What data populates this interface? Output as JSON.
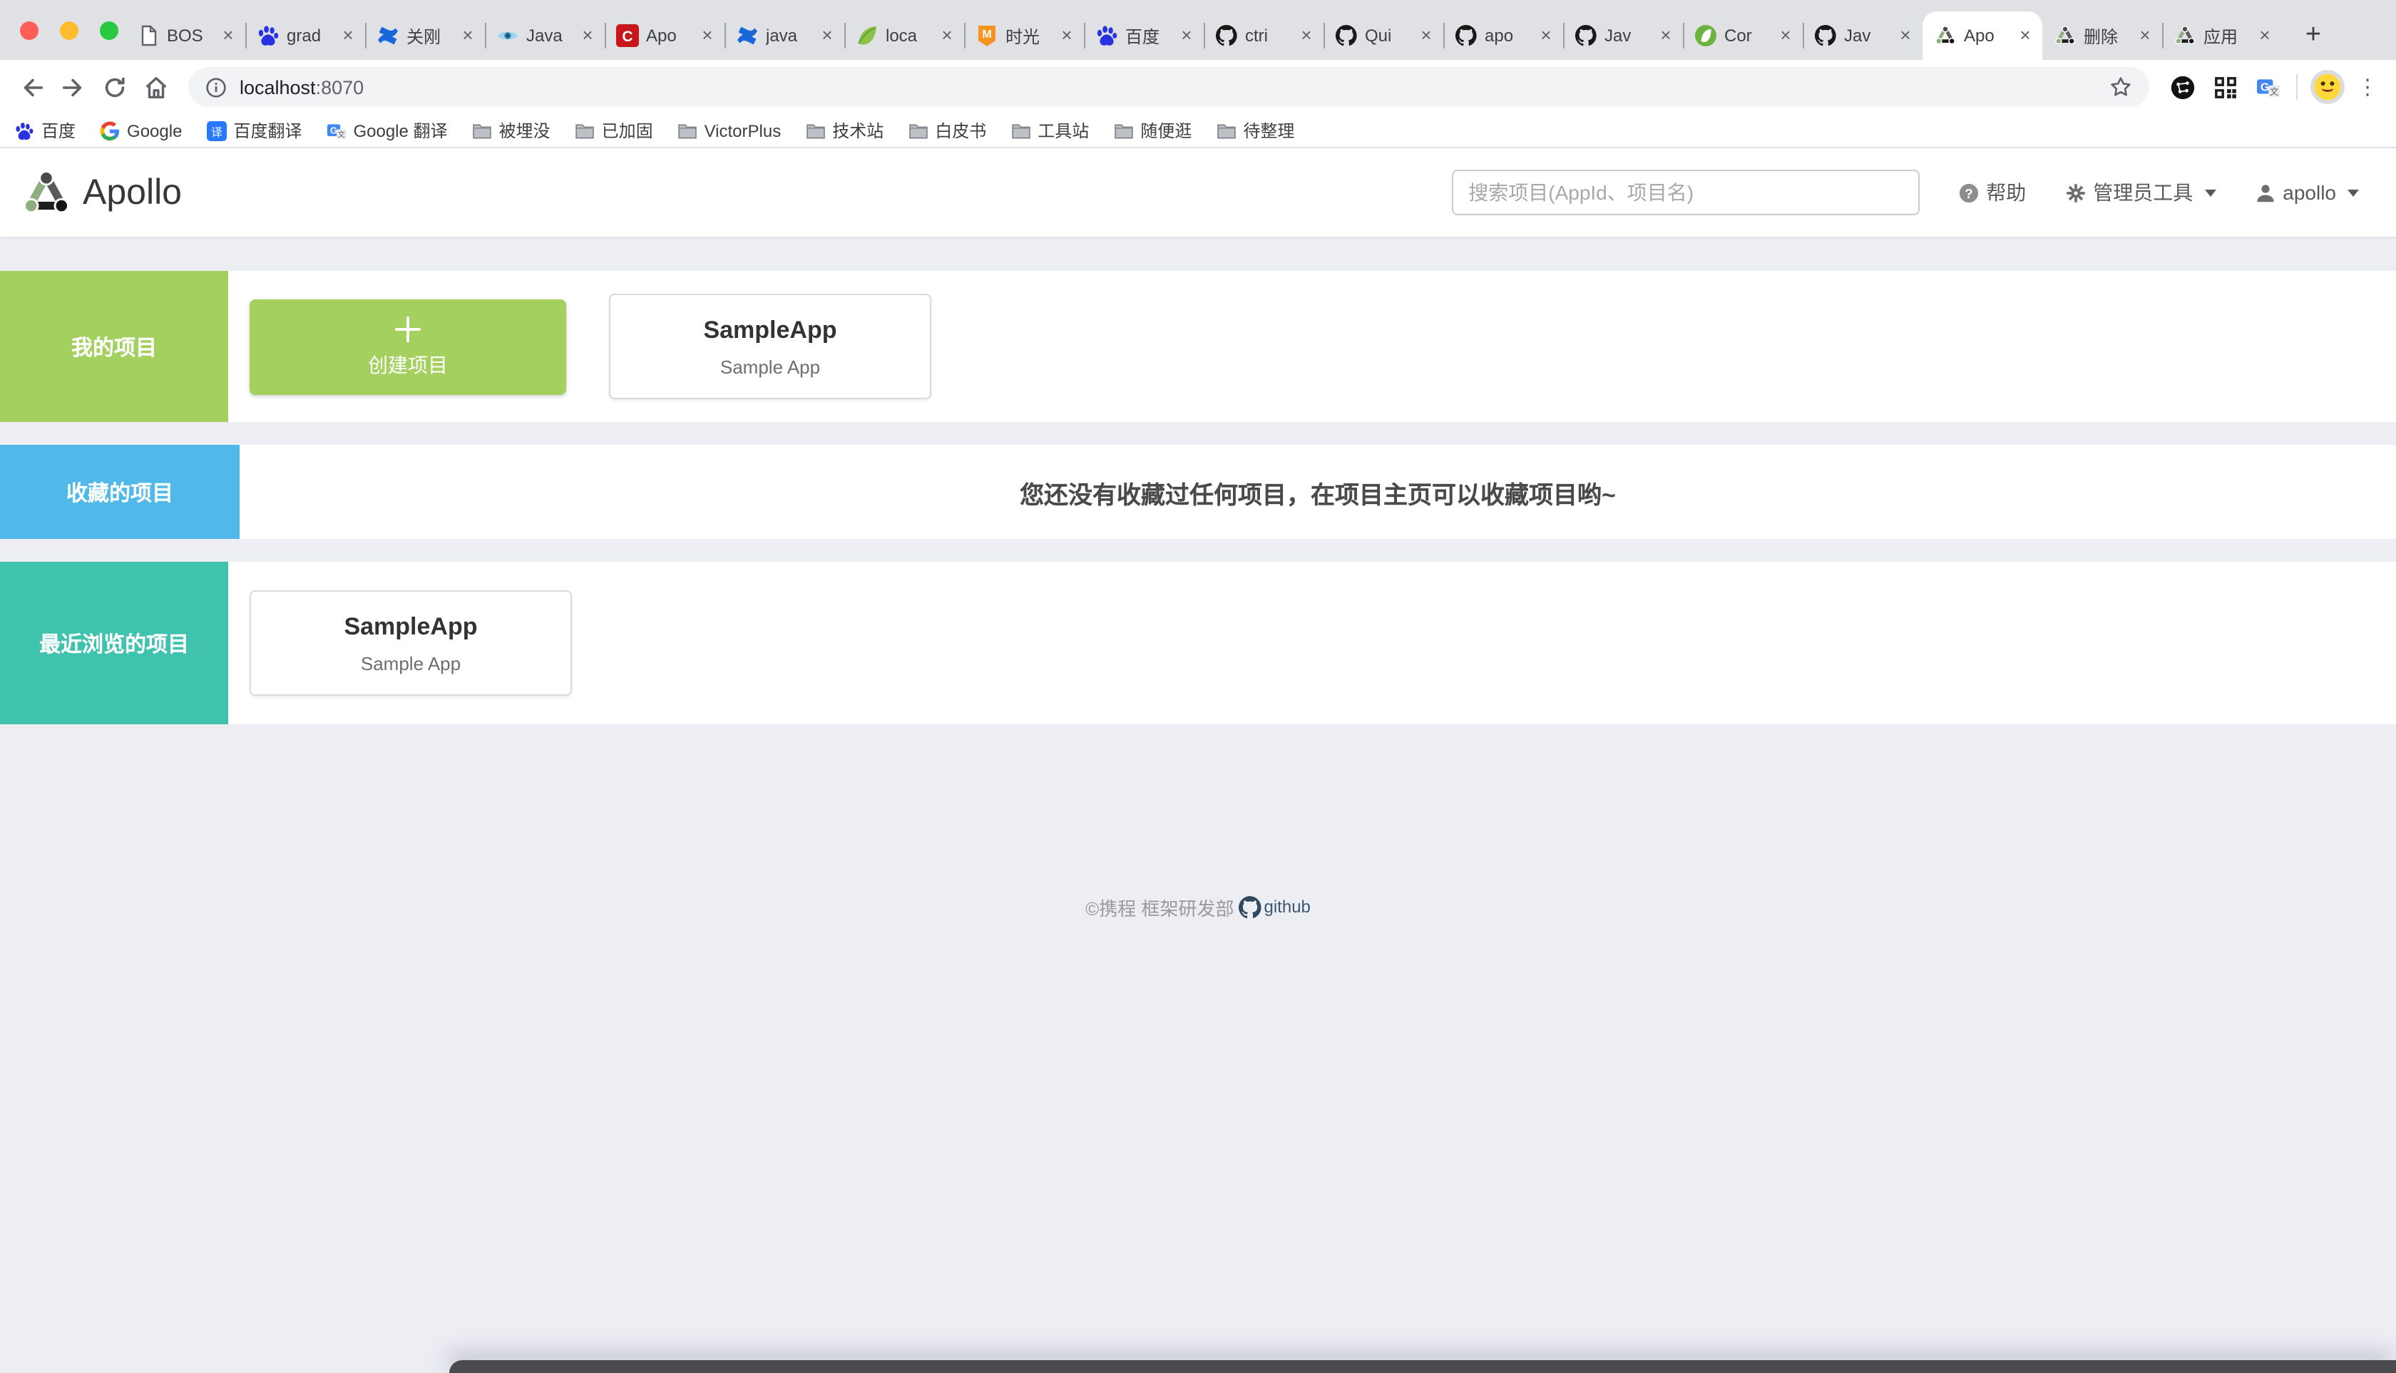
{
  "browser": {
    "tabs": [
      {
        "title": "BOS",
        "icon": "doc"
      },
      {
        "title": "grad",
        "icon": "baidu"
      },
      {
        "title": "关刚",
        "icon": "confluence"
      },
      {
        "title": "Java",
        "icon": "eye"
      },
      {
        "title": "Apo",
        "icon": "csdn"
      },
      {
        "title": "java",
        "icon": "confluence"
      },
      {
        "title": "loca",
        "icon": "leaf"
      },
      {
        "title": "时光",
        "icon": "md"
      },
      {
        "title": "百度",
        "icon": "baidu"
      },
      {
        "title": "ctri",
        "icon": "github"
      },
      {
        "title": "Qui",
        "icon": "github"
      },
      {
        "title": "apo",
        "icon": "github"
      },
      {
        "title": "Jav",
        "icon": "github"
      },
      {
        "title": "Cor",
        "icon": "springboot"
      },
      {
        "title": "Jav",
        "icon": "github"
      },
      {
        "title": "Apo",
        "icon": "apollo",
        "active": true
      },
      {
        "title": "删除",
        "icon": "apollo"
      },
      {
        "title": "应用",
        "icon": "apollo"
      }
    ],
    "tab_close_glyph": "×",
    "new_tab_label": "+",
    "toolbar": {
      "url_host": "localhost",
      "url_port": ":8070",
      "menu_glyph": "⋮"
    },
    "bookmarks_bar": [
      {
        "label": "百度",
        "icon": "baidu"
      },
      {
        "label": "Google",
        "icon": "google"
      },
      {
        "label": "百度翻译",
        "icon": "fanyi"
      },
      {
        "label": "Google 翻译",
        "icon": "gtranslate"
      },
      {
        "label": "被埋没",
        "icon": "folder"
      },
      {
        "label": "已加固",
        "icon": "folder"
      },
      {
        "label": "VictorPlus",
        "icon": "folder"
      },
      {
        "label": "技术站",
        "icon": "folder"
      },
      {
        "label": "白皮书",
        "icon": "folder"
      },
      {
        "label": "工具站",
        "icon": "folder"
      },
      {
        "label": "随便逛",
        "icon": "folder"
      },
      {
        "label": "待整理",
        "icon": "folder"
      }
    ]
  },
  "app": {
    "brand": "Apollo",
    "search_placeholder": "搜索项目(AppId、项目名)",
    "nav": {
      "help": "帮助",
      "admin_tools": "管理员工具",
      "username": "apollo"
    },
    "sections": {
      "my_projects": {
        "label": "我的项目",
        "create_button": "创建项目",
        "card": {
          "title": "SampleApp",
          "subtitle": "Sample App"
        }
      },
      "favorites": {
        "label": "收藏的项目",
        "empty_message": "您还没有收藏过任何项目，在项目主页可以收藏项目哟~"
      },
      "recent": {
        "label": "最近浏览的项目",
        "card": {
          "title": "SampleApp",
          "subtitle": "Sample App"
        }
      }
    },
    "footer": {
      "copyright": "©携程 框架研发部",
      "github": "github"
    }
  },
  "colors": {
    "green": "#A3D05F",
    "blue": "#50B9E9",
    "teal": "#3FC2AE",
    "page_bg": "#EDEEF4",
    "chrome_bg": "#DFE1E5"
  }
}
